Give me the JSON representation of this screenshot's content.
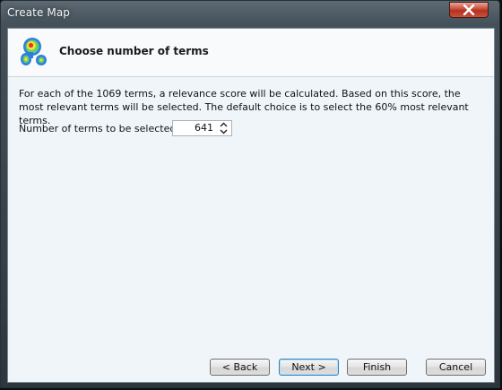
{
  "window": {
    "title": "Create Map",
    "close_icon": "close-icon"
  },
  "header": {
    "heading": "Choose number of terms",
    "logo_icon": "vosviewer-density-logo-icon"
  },
  "body": {
    "description": "For each of the 1069 terms, a relevance score will be calculated. Based on this score, the most relevant terms will be selected. The default choice is to select the 60% most relevant terms.",
    "field_label": "Number of terms to be selected:",
    "field_value": "641"
  },
  "buttons": {
    "back": "< Back",
    "next": "Next >",
    "finish": "Finish",
    "cancel": "Cancel"
  },
  "colors": {
    "close_button": "#c74b37",
    "client_background": "#f0f5fa",
    "default_button_border": "#3c7fb1"
  }
}
